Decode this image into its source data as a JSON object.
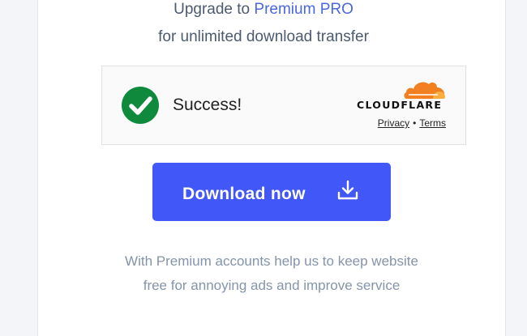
{
  "upgrade": {
    "prefix": "Upgrade to",
    "link_label": "Premium PRO",
    "subtitle": "for unlimited download transfer"
  },
  "captcha": {
    "status": "Success!",
    "status_icon": "checkmark-circle-icon",
    "provider": "CLOUDFLARE",
    "privacy_label": "Privacy",
    "separator": "•",
    "terms_label": "Terms",
    "colors": {
      "success": "#0f8a3c",
      "cloud_orange": "#f38020",
      "cloud_light": "#faae40"
    }
  },
  "download_button": {
    "label": "Download now",
    "icon": "download-icon",
    "color": "#4257f7"
  },
  "promo": {
    "line1": "With Premium accounts help us to keep website",
    "line2": "free for annoying ads and improve service"
  }
}
